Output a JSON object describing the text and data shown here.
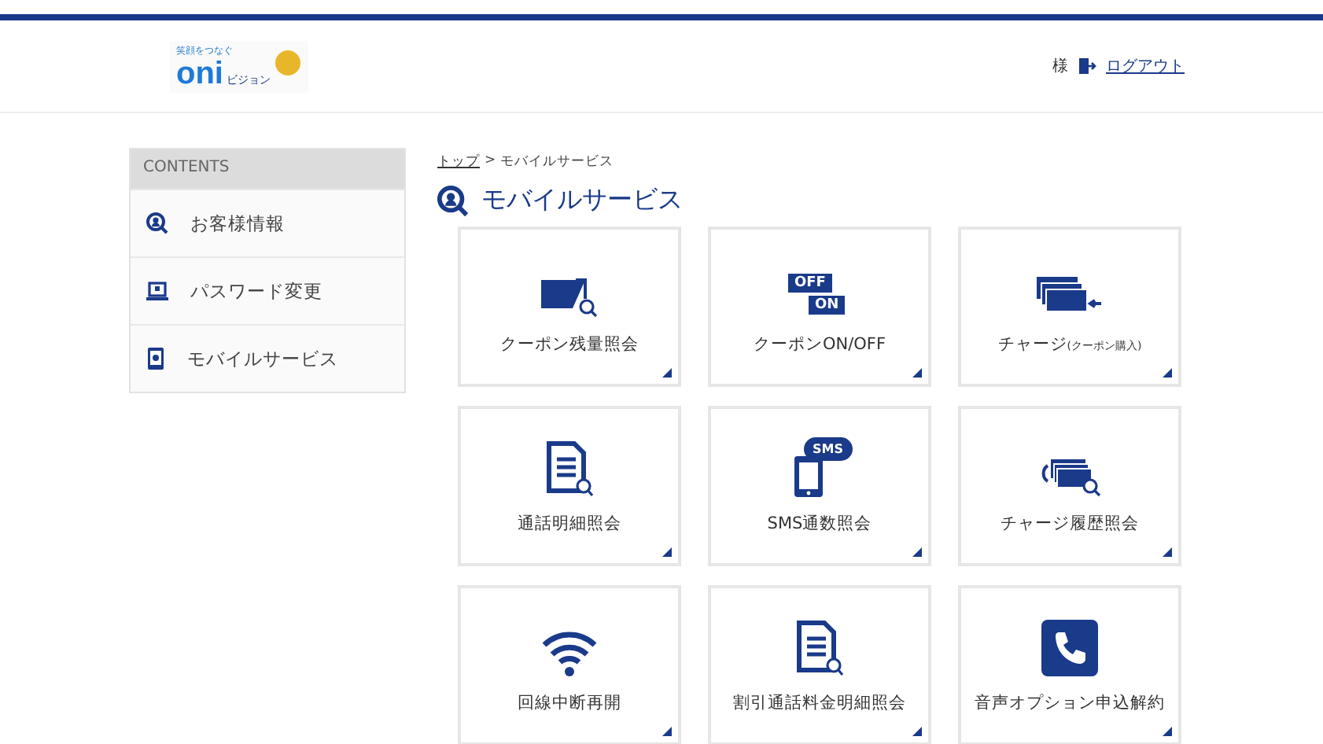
{
  "header": {
    "logo": {
      "tagline": "笑顔をつなぐ",
      "mark": "oni",
      "suffix": "ビジョン"
    },
    "honorific": "様",
    "logout": "ログアウト"
  },
  "sidebar": {
    "heading": "CONTENTS",
    "items": [
      {
        "label": "お客様情報",
        "kind": "user-search"
      },
      {
        "label": "パスワード変更",
        "kind": "laptop"
      },
      {
        "label": "モバイルサービス",
        "kind": "phone"
      }
    ]
  },
  "breadcrumb": {
    "link": "トップ",
    "separator": ">",
    "current": "モバイルサービス"
  },
  "page_title": "モバイルサービス",
  "tiles": [
    {
      "label": "クーポン残量照会",
      "kind": "card-search"
    },
    {
      "label": "クーポンON/OFF",
      "kind": "off-on",
      "icon_text": [
        "OFF",
        "ON"
      ]
    },
    {
      "label": "チャージ",
      "note": "(クーポン購入)",
      "kind": "cards-arrow"
    },
    {
      "label": "通話明細照会",
      "kind": "doc-search"
    },
    {
      "label": "SMS通数照会",
      "kind": "sms",
      "icon_text": [
        "SMS"
      ]
    },
    {
      "label": "チャージ履歴照会",
      "kind": "cards-history"
    },
    {
      "label": "回線中断再開",
      "kind": "wifi"
    },
    {
      "label": "割引通話料金明細照会",
      "kind": "doc-search"
    },
    {
      "label": "音声オプション申込解約",
      "kind": "phone-square"
    }
  ]
}
